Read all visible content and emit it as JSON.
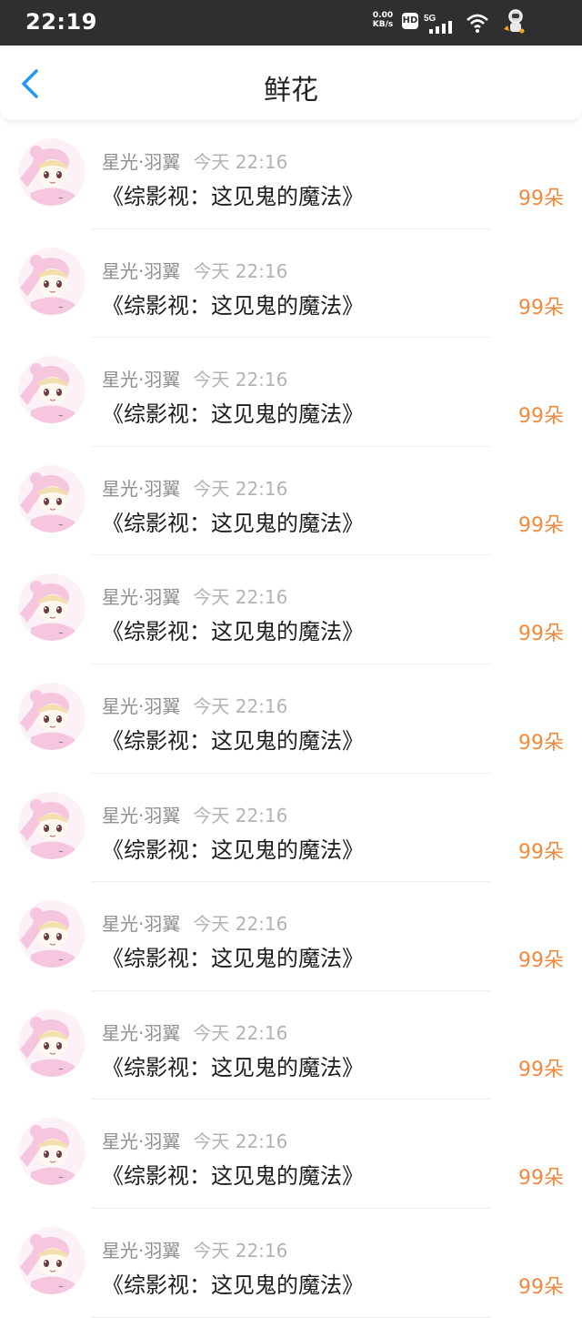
{
  "status_bar": {
    "time": "22:19",
    "net_speed_value": "0.00",
    "net_speed_unit": "KB/s",
    "hd_label": "HD",
    "network_label": "5G"
  },
  "header": {
    "title": "鲜花"
  },
  "icons": {
    "back": "chevron-left-icon",
    "avatar": "anime-girl-avatar"
  },
  "colors": {
    "accent_blue": "#2196f3",
    "count_orange": "#f08a3c",
    "avatar_pink": "#f6c6de"
  },
  "items": [
    {
      "user": "星光·羽翼",
      "time": "今天 22:16",
      "title": "《综影视：这见鬼的魔法》",
      "count": "99朵"
    },
    {
      "user": "星光·羽翼",
      "time": "今天 22:16",
      "title": "《综影视：这见鬼的魔法》",
      "count": "99朵"
    },
    {
      "user": "星光·羽翼",
      "time": "今天 22:16",
      "title": "《综影视：这见鬼的魔法》",
      "count": "99朵"
    },
    {
      "user": "星光·羽翼",
      "time": "今天 22:16",
      "title": "《综影视：这见鬼的魔法》",
      "count": "99朵"
    },
    {
      "user": "星光·羽翼",
      "time": "今天 22:16",
      "title": "《综影视：这见鬼的魔法》",
      "count": "99朵"
    },
    {
      "user": "星光·羽翼",
      "time": "今天 22:16",
      "title": "《综影视：这见鬼的魔法》",
      "count": "99朵"
    },
    {
      "user": "星光·羽翼",
      "time": "今天 22:16",
      "title": "《综影视：这见鬼的魔法》",
      "count": "99朵"
    },
    {
      "user": "星光·羽翼",
      "time": "今天 22:16",
      "title": "《综影视：这见鬼的魔法》",
      "count": "99朵"
    },
    {
      "user": "星光·羽翼",
      "time": "今天 22:16",
      "title": "《综影视：这见鬼的魔法》",
      "count": "99朵"
    },
    {
      "user": "星光·羽翼",
      "time": "今天 22:16",
      "title": "《综影视：这见鬼的魔法》",
      "count": "99朵"
    },
    {
      "user": "星光·羽翼",
      "time": "今天 22:16",
      "title": "《综影视：这见鬼的魔法》",
      "count": "99朵"
    }
  ]
}
